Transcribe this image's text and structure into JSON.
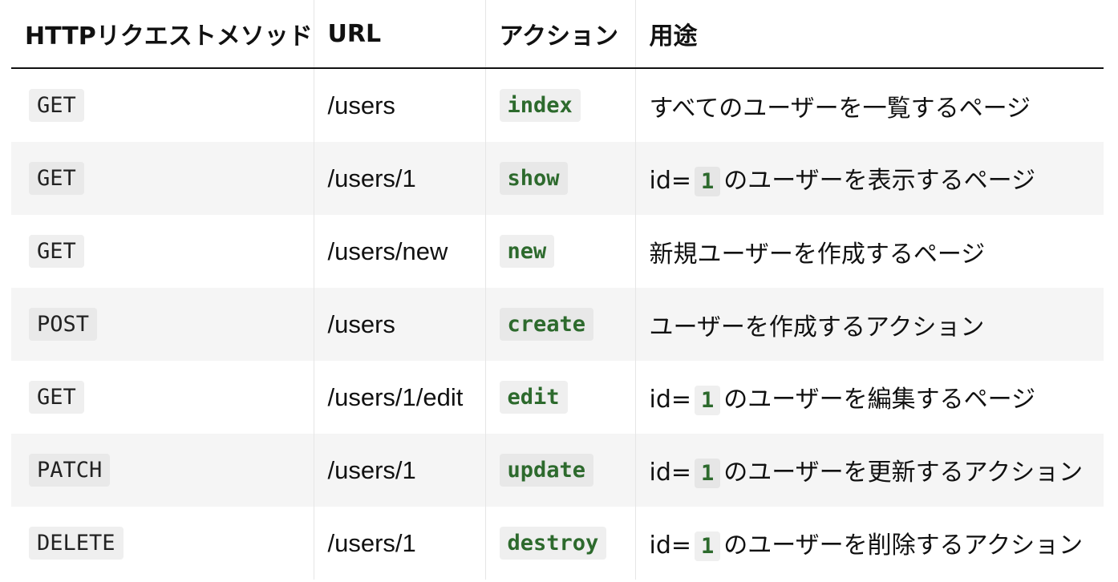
{
  "table": {
    "headers": [
      "HTTPリクエストメソッド",
      "URL",
      "アクション",
      "用途"
    ],
    "rows": [
      {
        "method": "GET",
        "url": "/users",
        "action": "index",
        "desc": "すべてのユーザーを一覧するページ"
      },
      {
        "method": "GET",
        "url": "/users/1",
        "action": "show",
        "desc_prefix": "id=",
        "desc_code": "1",
        "desc_suffix": "のユーザーを表示するページ"
      },
      {
        "method": "GET",
        "url": "/users/new",
        "action": "new",
        "desc": "新規ユーザーを作成するページ"
      },
      {
        "method": "POST",
        "url": "/users",
        "action": "create",
        "desc": "ユーザーを作成するアクション"
      },
      {
        "method": "GET",
        "url": "/users/1/edit",
        "action": "edit",
        "desc_prefix": "id=",
        "desc_code": "1",
        "desc_suffix": "のユーザーを編集するページ"
      },
      {
        "method": "PATCH",
        "url": "/users/1",
        "action": "update",
        "desc_prefix": "id=",
        "desc_code": "1",
        "desc_suffix": "のユーザーを更新するアクション"
      },
      {
        "method": "DELETE",
        "url": "/users/1",
        "action": "destroy",
        "desc_prefix": "id=",
        "desc_code": "1",
        "desc_suffix": "のユーザーを削除するアクション"
      }
    ]
  },
  "colors": {
    "action_text": "#2d6a2d",
    "stripe_bg": "#f5f5f5"
  }
}
